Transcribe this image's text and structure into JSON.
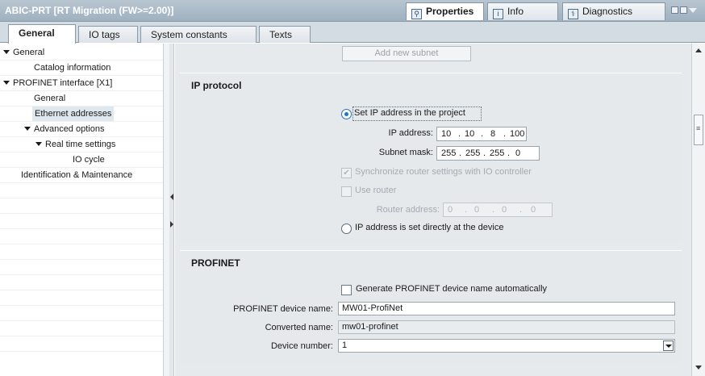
{
  "window": {
    "title": "ABIC-PRT [RT Migration (FW>=2.00)]",
    "tabs": [
      {
        "label": "Properties",
        "icon": "properties-icon"
      },
      {
        "label": "Info",
        "icon": "info-icon"
      },
      {
        "label": "Diagnostics",
        "icon": "diagnostics-icon"
      }
    ]
  },
  "subtabs": [
    "General",
    "IO tags",
    "System constants",
    "Texts"
  ],
  "nav": {
    "items": [
      {
        "label": "General",
        "level": 0,
        "expanded": true
      },
      {
        "label": "Catalog information",
        "level": 1
      },
      {
        "label": "PROFINET interface [X1]",
        "level": 0,
        "expanded": true
      },
      {
        "label": "General",
        "level": 1
      },
      {
        "label": "Ethernet addresses",
        "level": 1,
        "selected": true
      },
      {
        "label": "Advanced options",
        "level": 1,
        "expanded": true
      },
      {
        "label": "Real time settings",
        "level": 2,
        "expanded": true
      },
      {
        "label": "IO cycle",
        "level": 3
      },
      {
        "label": "Identification & Maintenance",
        "level": 0
      }
    ]
  },
  "subnet": {
    "add_label": "Add new subnet"
  },
  "ip_protocol": {
    "title": "IP protocol",
    "set_in_project_label": "Set IP address in the project",
    "ip_address_label": "IP address:",
    "ip_address": [
      "10",
      "10",
      "8",
      "100"
    ],
    "subnet_mask_label": "Subnet mask:",
    "subnet_mask": [
      "255",
      "255",
      "255",
      "0"
    ],
    "sync_router_label": "Synchronize router settings with IO controller",
    "use_router_label": "Use router",
    "router_address_label": "Router address:",
    "router_address": [
      "0",
      "0",
      "0",
      "0"
    ],
    "set_directly_label": "IP address is set directly at the device"
  },
  "profinet": {
    "title": "PROFINET",
    "generate_name_label": "Generate PROFINET device name automatically",
    "device_name_label": "PROFINET device name:",
    "device_name": "MW01-ProfiNet",
    "converted_name_label": "Converted name:",
    "converted_name": "mw01-profinet",
    "device_number_label": "Device number:",
    "device_number": "1"
  },
  "colors": {
    "titlebar": "#9fb0bf",
    "selection": "#dfe7ef",
    "radio_accent": "#1f73c9"
  }
}
